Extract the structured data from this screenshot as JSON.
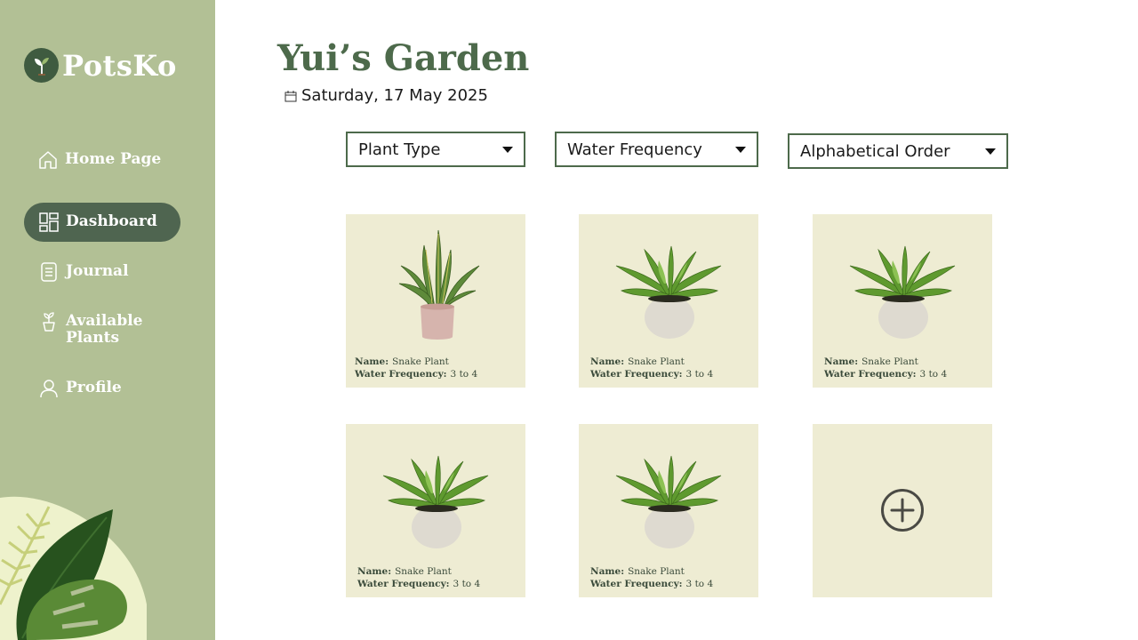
{
  "app": {
    "name": "PotsKo"
  },
  "sidebar": {
    "items": [
      {
        "label": "Home Page",
        "icon": "home-icon"
      },
      {
        "label": "Dashboard",
        "icon": "dashboard-icon",
        "active": true
      },
      {
        "label": "Journal",
        "icon": "journal-icon"
      },
      {
        "label": "Available Plants",
        "icon": "plant-pot-icon"
      },
      {
        "label": "Profile",
        "icon": "user-icon"
      }
    ]
  },
  "header": {
    "title": "Yui’s Garden",
    "date": "Saturday, 17 May 2025"
  },
  "filters": [
    {
      "label": "Plant Type"
    },
    {
      "label": "Water Frequency"
    },
    {
      "label": "Alphabetical Order"
    }
  ],
  "cards": [
    {
      "name_label": "Name:",
      "name": "Snake Plant",
      "water_label": "Water Frequency:",
      "water": "3 to 4",
      "image": "snake-plant"
    },
    {
      "name_label": "Name:",
      "name": "Snake Plant",
      "water_label": "Water Frequency:",
      "water": "3 to 4",
      "image": "fern-plant"
    },
    {
      "name_label": "Name:",
      "name": "Snake Plant",
      "water_label": "Water Frequency:",
      "water": "3 to 4",
      "image": "fern-plant"
    },
    {
      "name_label": "Name:",
      "name": "Snake Plant",
      "water_label": "Water Frequency:",
      "water": "3 to 4",
      "image": "fern-plant"
    },
    {
      "name_label": "Name:",
      "name": "Snake Plant",
      "water_label": "Water Frequency:",
      "water": "3 to 4",
      "image": "fern-plant"
    }
  ],
  "add_card": {
    "icon": "plus-circle-icon"
  },
  "colors": {
    "sidebar": "#b2c095",
    "accent": "#4d6a4b",
    "active_nav": "#4f6550",
    "card": "#eeecd3"
  }
}
